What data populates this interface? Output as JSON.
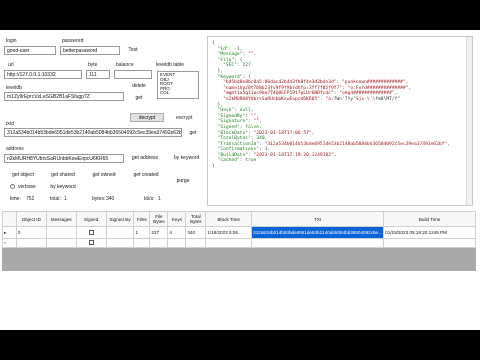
{
  "form": {
    "login_label": "login",
    "password_label": "password",
    "login_value": "good-user",
    "password_value": "betterpassword",
    "test_button": "Test",
    "url_label": "url",
    "url_value": "http://127.0.0.1:10332",
    "byte_label": "byte",
    "byte_value": "111",
    "balance_label": "balance",
    "leveldb_table_label": "leveldb table",
    "leveldb_options": [
      "EVENT",
      "OBJ",
      "ROOT",
      "PRO",
      "COL"
    ],
    "leveldb_label": "leveldb",
    "leveldb_value": "m1Zy9rEprcVxLeSGB2B1aFSfugp7Z",
    "delete_button": "delete",
    "get_button": "get",
    "decrypt_button": "decrypt",
    "encrypt_label": "encrypt",
    "txid_label": "txid",
    "txid_value": "312a534b014b53bde6951de53b2140ab5084bb36504092c5ec39ea37492e62bf",
    "get_txid_button": "get",
    "address_label": "address",
    "address_value": "n2kMURH8YUbrsSaRUnbbKswEopcU6KR65",
    "get_address_button": "get address",
    "by_keyword_label": "by keyword",
    "get_object_button": "get object",
    "get_shared_button": "get shared",
    "get_owned_button": "get owned",
    "get_created_button": "get created",
    "purge_button": "purge",
    "verbose_label": "verbose",
    "by_keyword_button": "by keyword",
    "time_label": "time:",
    "time_value": "752",
    "total_label": "total:",
    "total_value": "1",
    "bytes_label": "bytes:",
    "bytes_value": "340",
    "kbs_label": "kb/s:",
    "kbs_value": "1"
  },
  "json_lines": [
    [
      [
        "p",
        "{"
      ]
    ],
    [
      [
        "p",
        "  "
      ],
      [
        "k",
        "\"Id\""
      ],
      [
        "p",
        ": "
      ],
      [
        "n",
        "-1,"
      ]
    ],
    [
      [
        "p",
        "  "
      ],
      [
        "k",
        "\"Message\""
      ],
      [
        "p",
        ": "
      ],
      [
        "s",
        "\"\","
      ]
    ],
    [
      [
        "p",
        "  "
      ],
      [
        "k",
        "\"File\""
      ],
      [
        "p",
        ": {"
      ]
    ],
    [
      [
        "p",
        "    "
      ],
      [
        "k",
        "\"SEC\""
      ],
      [
        "p",
        ": "
      ],
      [
        "n",
        "227"
      ]
    ],
    [
      [
        "p",
        "  },"
      ]
    ],
    [
      [
        "p",
        "  "
      ],
      [
        "k",
        "\"Keyword\""
      ],
      [
        "p",
        ": {"
      ]
    ],
    [
      [
        "p",
        "    "
      ],
      [
        "s",
        "\"bd5bd8e8bc8a5:86dacd2b4d3fb8f4e3d3b4e3d\""
      ],
      [
        "p",
        ": "
      ],
      [
        "s",
        "\"punknown#############\","
      ]
    ],
    [
      [
        "p",
        "    "
      ],
      [
        "s",
        "\"name1hp20t7b8b23fv9f9f9brdhfp:3ff7f05f9f7\""
      ],
      [
        "p",
        ": "
      ],
      [
        "s",
        "\"o:Ford##############\","
      ]
    ],
    [
      [
        "p",
        "    "
      ],
      [
        "s",
        "\"mgmt1a5g11ac9bm7T4Q0EFP19t7pLUr6NBfcdc\""
      ],
      [
        "p",
        ": "
      ],
      [
        "s",
        "\"omg4##############\","
      ]
    ],
    [
      [
        "p",
        "    "
      ],
      [
        "s",
        "\"n2kMURH8YUbrsSaRUnbbKswEopcU6KR65\""
      ],
      [
        "p",
        ": "
      ],
      [
        "s",
        "\"o:"
      ],
      [
        "p",
        "7Wn'7Yy\""
      ],
      [
        "s",
        "Sjx-\\'"
      ],
      [
        "p",
        "\\fm8\\MT/f\""
      ]
    ],
    [
      [
        "p",
        "  },"
      ]
    ],
    [
      [
        "p",
        "  "
      ],
      [
        "k",
        "\"Hash\""
      ],
      [
        "p",
        ": "
      ],
      [
        "n",
        "null,"
      ]
    ],
    [
      [
        "p",
        "  "
      ],
      [
        "k",
        "\"SignedBy\""
      ],
      [
        "p",
        ": "
      ],
      [
        "s",
        "\"\","
      ]
    ],
    [
      [
        "p",
        "  "
      ],
      [
        "k",
        "\"Signature\""
      ],
      [
        "p",
        ": "
      ],
      [
        "s",
        "\"\","
      ]
    ],
    [
      [
        "p",
        "  "
      ],
      [
        "k",
        "\"Signed\""
      ],
      [
        "p",
        ": "
      ],
      [
        "n",
        "false,"
      ]
    ],
    [
      [
        "p",
        "  "
      ],
      [
        "k",
        "\"BlockDate\""
      ],
      [
        "p",
        ": "
      ],
      [
        "s",
        "\"2023-01-18T17:06:57\","
      ]
    ],
    [
      [
        "p",
        "  "
      ],
      [
        "k",
        "\"TotalBytes\""
      ],
      [
        "p",
        ": "
      ],
      [
        "n",
        "340,"
      ]
    ],
    [
      [
        "p",
        "  "
      ],
      [
        "k",
        "\"TransactionId\""
      ],
      [
        "p",
        ": "
      ],
      [
        "s",
        "\"312a534b014b53bde6951de53b2140ab5084bb36504092c5ec39ea37492e62bf\","
      ]
    ],
    [
      [
        "p",
        "  "
      ],
      [
        "k",
        "\"Confirmations\""
      ],
      [
        "p",
        ": "
      ],
      [
        "n",
        "1,"
      ]
    ],
    [
      [
        "p",
        "  "
      ],
      [
        "k",
        "\"BuildDate\""
      ],
      [
        "p",
        ": "
      ],
      [
        "s",
        "\"2023-01-18T17:19:20.1249302\","
      ]
    ],
    [
      [
        "p",
        "  "
      ],
      [
        "k",
        "\"Cached\""
      ],
      [
        "p",
        ": "
      ],
      [
        "n",
        "true"
      ]
    ],
    [
      [
        "p",
        "}"
      ]
    ]
  ],
  "grid": {
    "columns": [
      "",
      "Object ID",
      "Messages",
      "Signed",
      "Signed By",
      "Files",
      "File Bytes",
      "Keys",
      "Total Bytes",
      "Block Time",
      "TXI",
      "Build Time"
    ],
    "rows": [
      [
        "▸",
        "0",
        "",
        "checkbox",
        "",
        "1",
        "227",
        "4",
        "340",
        "1/18/2023 5:06...",
        "312a534b014b53bde6951de53b2140ab5084bb36504092c5e...",
        "01/18/2023 05:19:20.1249 PM"
      ],
      [
        "*",
        "",
        "",
        "checkbox",
        "",
        "",
        "",
        "",
        "",
        "",
        "",
        ""
      ]
    ]
  }
}
